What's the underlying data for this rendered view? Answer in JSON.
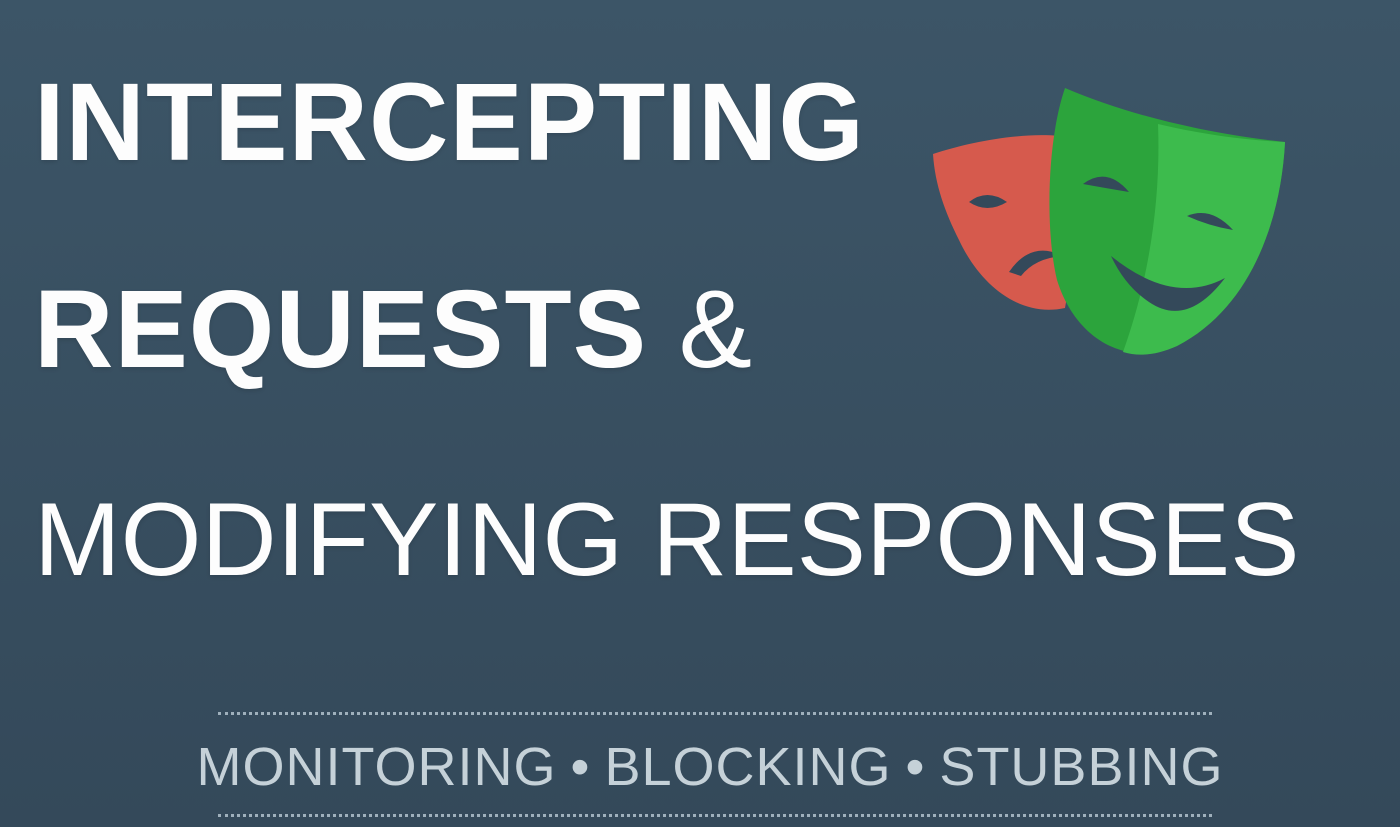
{
  "title": {
    "line1": "INTERCEPTING",
    "line2_word": "REQUESTS",
    "line2_amp": "&",
    "line3": "MODIFYING RESPONSES"
  },
  "tagline": {
    "items": [
      "MONITORING",
      "BLOCKING",
      "STUBBING"
    ],
    "separator": "•"
  },
  "logo": {
    "icon": "theater-masks-icon",
    "colors": {
      "sad_mask": "#d65a4d",
      "happy_mask": "#2ca43c",
      "happy_mask_light": "#3dbb4d",
      "eye_cutout": "#34495a"
    }
  },
  "colors": {
    "background": "#3c5567",
    "title_text": "#fdfdfd",
    "tagline_text": "#c5d1d8"
  }
}
